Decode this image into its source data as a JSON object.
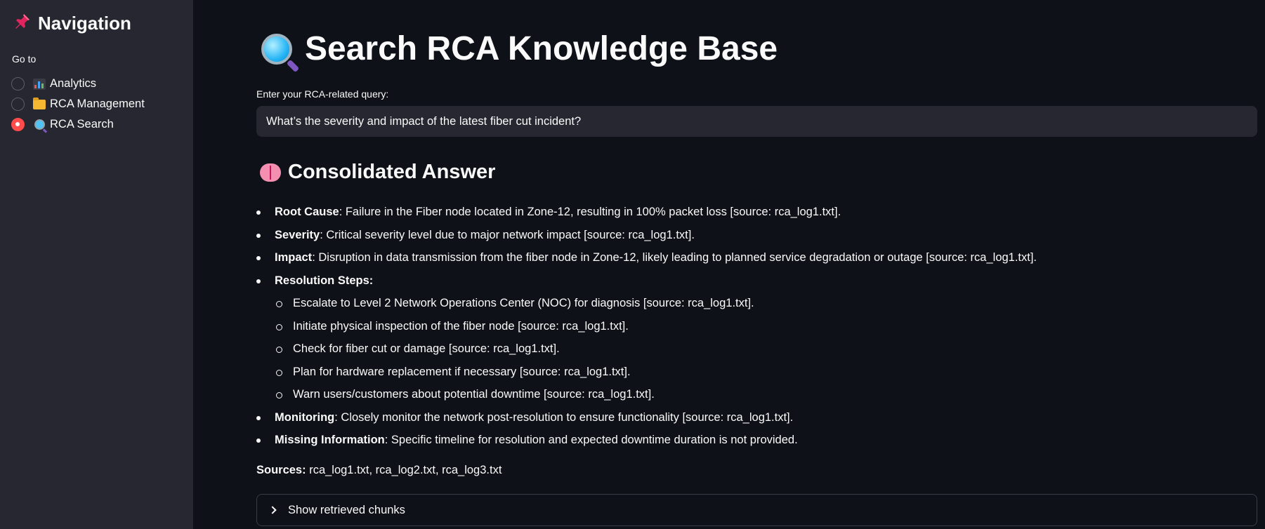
{
  "sidebar": {
    "title": "Navigation",
    "title_icon": "pushpin-icon",
    "radio_label": "Go to",
    "items": [
      {
        "label": "Analytics",
        "icon": "bar-chart-icon",
        "selected": false
      },
      {
        "label": "RCA Management",
        "icon": "folder-icon",
        "selected": false
      },
      {
        "label": "RCA Search",
        "icon": "magnifier-icon",
        "selected": true
      }
    ]
  },
  "main": {
    "title": "Search RCA Knowledge Base",
    "title_icon": "magnifier-icon",
    "query_label": "Enter your RCA-related query:",
    "query_value": "What’s the severity and impact of the latest fiber cut incident?",
    "answer_heading": "Consolidated Answer",
    "answer_heading_icon": "brain-icon",
    "answer": {
      "root_cause": {
        "key": "Root Cause",
        "text": ": Failure in the Fiber node located in Zone-12, resulting in 100% packet loss [source: rca_log1.txt]."
      },
      "severity": {
        "key": "Severity",
        "text": ": Critical severity level due to major network impact [source: rca_log1.txt]."
      },
      "impact": {
        "key": "Impact",
        "text": ": Disruption in data transmission from the fiber node in Zone-12, likely leading to planned service degradation or outage [source: rca_log1.txt]."
      },
      "resolution": {
        "key": "Resolution Steps",
        "text": ":",
        "steps": [
          "Escalate to Level 2 Network Operations Center (NOC) for diagnosis [source: rca_log1.txt].",
          "Initiate physical inspection of the fiber node [source: rca_log1.txt].",
          "Check for fiber cut or damage [source: rca_log1.txt].",
          "Plan for hardware replacement if necessary [source: rca_log1.txt].",
          "Warn users/customers about potential downtime [source: rca_log1.txt]."
        ]
      },
      "monitoring": {
        "key": "Monitoring",
        "text": ": Closely monitor the network post-resolution to ensure functionality [source: rca_log1.txt]."
      },
      "missing": {
        "key": "Missing Information",
        "text": ": Specific timeline for resolution and expected downtime duration is not provided."
      }
    },
    "sources_key": "Sources:",
    "sources_value": " rca_log1.txt, rca_log2.txt, rca_log3.txt",
    "expander_label": "Show retrieved chunks"
  },
  "colors": {
    "background": "#0e1117",
    "sidebar": "#262730",
    "accent": "#ff4b4b",
    "text": "#fafafa"
  }
}
